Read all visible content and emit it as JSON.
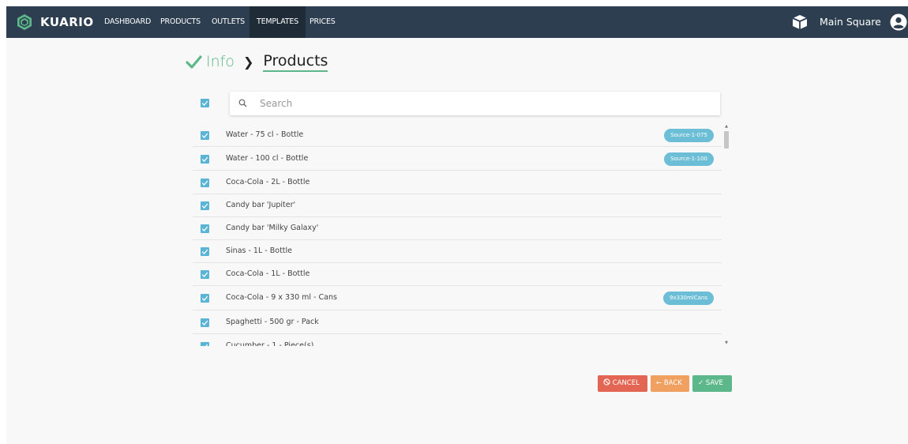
{
  "nav": {
    "brand": "KUARIO",
    "items": [
      {
        "label": "DASHBOARD"
      },
      {
        "label": "PRODUCTS"
      },
      {
        "label": "OUTLETS"
      },
      {
        "label": "TEMPLATES",
        "active": true
      },
      {
        "label": "PRICES"
      }
    ],
    "outlet_name": "Main Square",
    "icons": {
      "logo": "kuario-logo-icon",
      "outlet": "box-icon",
      "user": "user-icon"
    }
  },
  "wizard": {
    "step1": "Info",
    "step2": "Products",
    "step1_icon": "check-icon",
    "separator_icon": "chevron-right-icon"
  },
  "search": {
    "placeholder": "Search",
    "value": ""
  },
  "products": [
    {
      "name": "Water - 75 cl - Bottle",
      "tag": "Source-1-075",
      "checked": true
    },
    {
      "name": "Water - 100 cl - Bottle",
      "tag": "Source-1-100",
      "checked": true
    },
    {
      "name": "Coca-Cola - 2L - Bottle",
      "tag": "",
      "checked": true
    },
    {
      "name": "Candy bar 'Jupiter'",
      "tag": "",
      "checked": true
    },
    {
      "name": "Candy bar 'Milky Galaxy'",
      "tag": "",
      "checked": true
    },
    {
      "name": "Sinas - 1L - Bottle",
      "tag": "",
      "checked": true
    },
    {
      "name": "Coca-Cola - 1L - Bottle",
      "tag": "",
      "checked": true
    },
    {
      "name": "Coca-Cola - 9 x 330 ml - Cans",
      "tag": "9x330mlCans",
      "checked": true
    },
    {
      "name": "Spaghetti - 500 gr - Pack",
      "tag": "",
      "checked": true
    },
    {
      "name": "Cucumber - 1 - Piece(s)",
      "tag": "",
      "checked": true
    }
  ],
  "actions": {
    "cancel": "CANCEL",
    "back": "BACK",
    "save": "SAVE"
  },
  "colors": {
    "navbar": "#2c3e4f",
    "accent_green": "#5cb88a",
    "checkbox": "#5ab4d6",
    "tag": "#6cbdd6",
    "cancel": "#e26653",
    "back": "#f0a060",
    "save": "#5cb88a"
  }
}
